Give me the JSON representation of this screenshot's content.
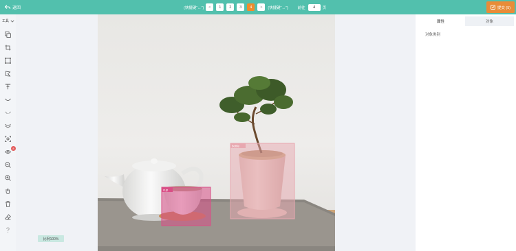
{
  "header": {
    "back_label": "返回",
    "prev_hint": "(快捷键“←”)",
    "next_hint": "(快捷键“→”)",
    "pages": [
      {
        "label": "<",
        "kind": "prev"
      },
      {
        "label": "1",
        "kind": "page"
      },
      {
        "label": "2",
        "kind": "page"
      },
      {
        "label": "3",
        "kind": "page"
      },
      {
        "label": "4",
        "kind": "active"
      },
      {
        "label": ">",
        "kind": "next"
      }
    ],
    "jump_label": "前往",
    "jump_value": "4",
    "page_unit": "页",
    "submit_label": "提交 (5)"
  },
  "toolbar": {
    "title": "工具",
    "tools": [
      "copy-icon",
      "crop-icon",
      "rectangle-icon",
      "polygon-icon",
      "text-format-icon",
      "curve-icon",
      "dashed-curve-icon",
      "double-curve-icon",
      "focus-icon",
      "eye-icon",
      "zoom-out-icon",
      "zoom-in-icon",
      "hand-icon",
      "trash-icon",
      "eraser-icon",
      "help-icon"
    ],
    "eye_badge": "8"
  },
  "canvas": {
    "zoom_label": "比例100%",
    "annotations": [
      {
        "label": "bottle",
        "color": "#e8a8b0"
      },
      {
        "label": "cup",
        "color": "#d94f86"
      }
    ]
  },
  "panel": {
    "tabs": [
      "属性",
      "对象"
    ],
    "active_tab": "属性",
    "category_label": "对象类别"
  },
  "colors": {
    "header": "#52c0ad",
    "accent": "#f08c2c",
    "submit": "#e88c38"
  }
}
